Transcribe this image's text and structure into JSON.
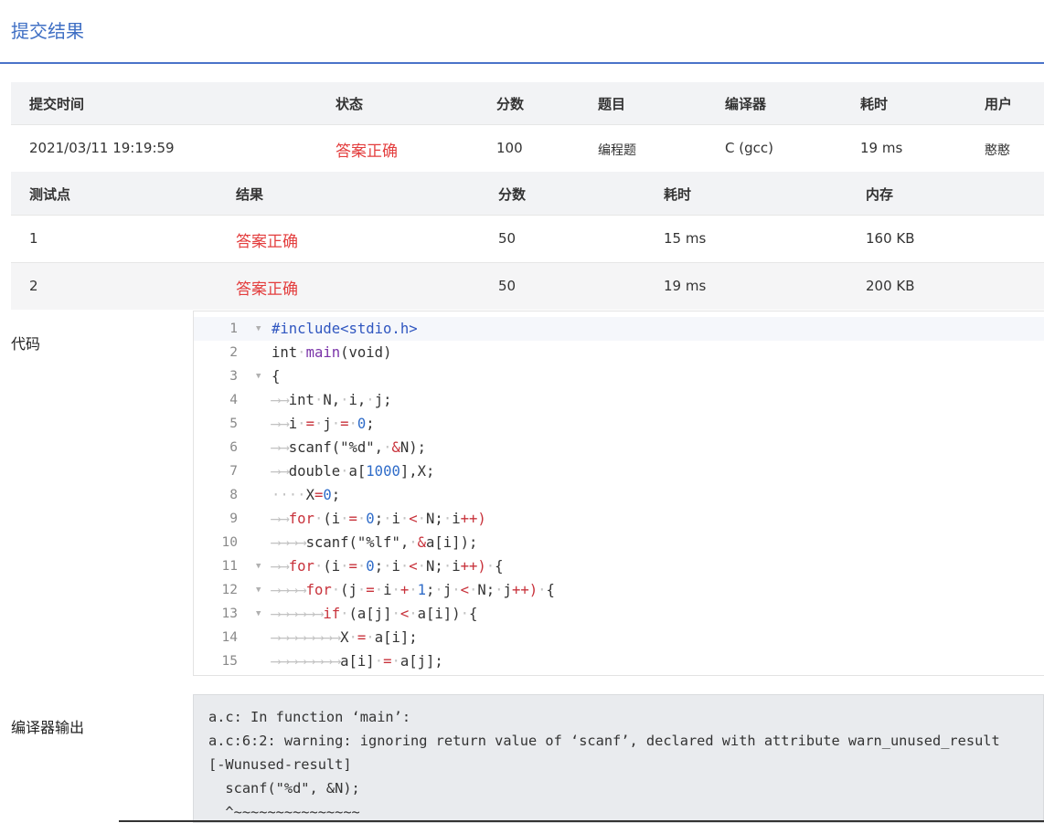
{
  "page": {
    "title": "提交结果"
  },
  "submission": {
    "headers": [
      "提交时间",
      "状态",
      "分数",
      "题目",
      "编译器",
      "耗时",
      "用户"
    ],
    "time": "2021/03/11 19:19:59",
    "status": "答案正确",
    "score": "100",
    "problem": "编程题",
    "compiler": "C (gcc)",
    "elapsed": "19 ms",
    "user": "憨憨"
  },
  "testcases": {
    "headers": [
      "测试点",
      "结果",
      "分数",
      "耗时",
      "内存"
    ],
    "rows": [
      {
        "id": "1",
        "result": "答案正确",
        "score": "50",
        "time": "15 ms",
        "memory": "160 KB"
      },
      {
        "id": "2",
        "result": "答案正确",
        "score": "50",
        "time": "19 ms",
        "memory": "200 KB"
      }
    ]
  },
  "code": {
    "label": "代码",
    "lines": [
      "#include<stdio.h>",
      "int main(void)",
      "{",
      "\tint N, i, j;",
      "\ti = j = 0;",
      "\tscanf(\"%d\", &N);",
      "\tdouble a[1000],X;",
      "    X=0;",
      "\tfor (i = 0; i < N; i++)",
      "\t\tscanf(\"%lf\", &a[i]);",
      "\tfor (i = 0; i < N; i++) {",
      "\t\tfor (j = i + 1; j < N; j++) {",
      "\t\t\tif (a[j] < a[i]) {",
      "\t\t\t\tX = a[i];",
      "\t\t\t\ta[i] = a[j];"
    ]
  },
  "compiler_output": {
    "label": "编译器输出",
    "text": "a.c: In function ‘main’:\na.c:6:2: warning: ignoring return value of ‘scanf’, declared with attribute warn_unused_result\n[-Wunused-result]\n  scanf(\"%d\", &N);\n  ^~~~~~~~~~~~~~~~"
  },
  "colors": {
    "accent": "#3f6fc4",
    "ok": "#e33d3d",
    "keyword": "#c8323b",
    "number": "#2f6cc9"
  }
}
